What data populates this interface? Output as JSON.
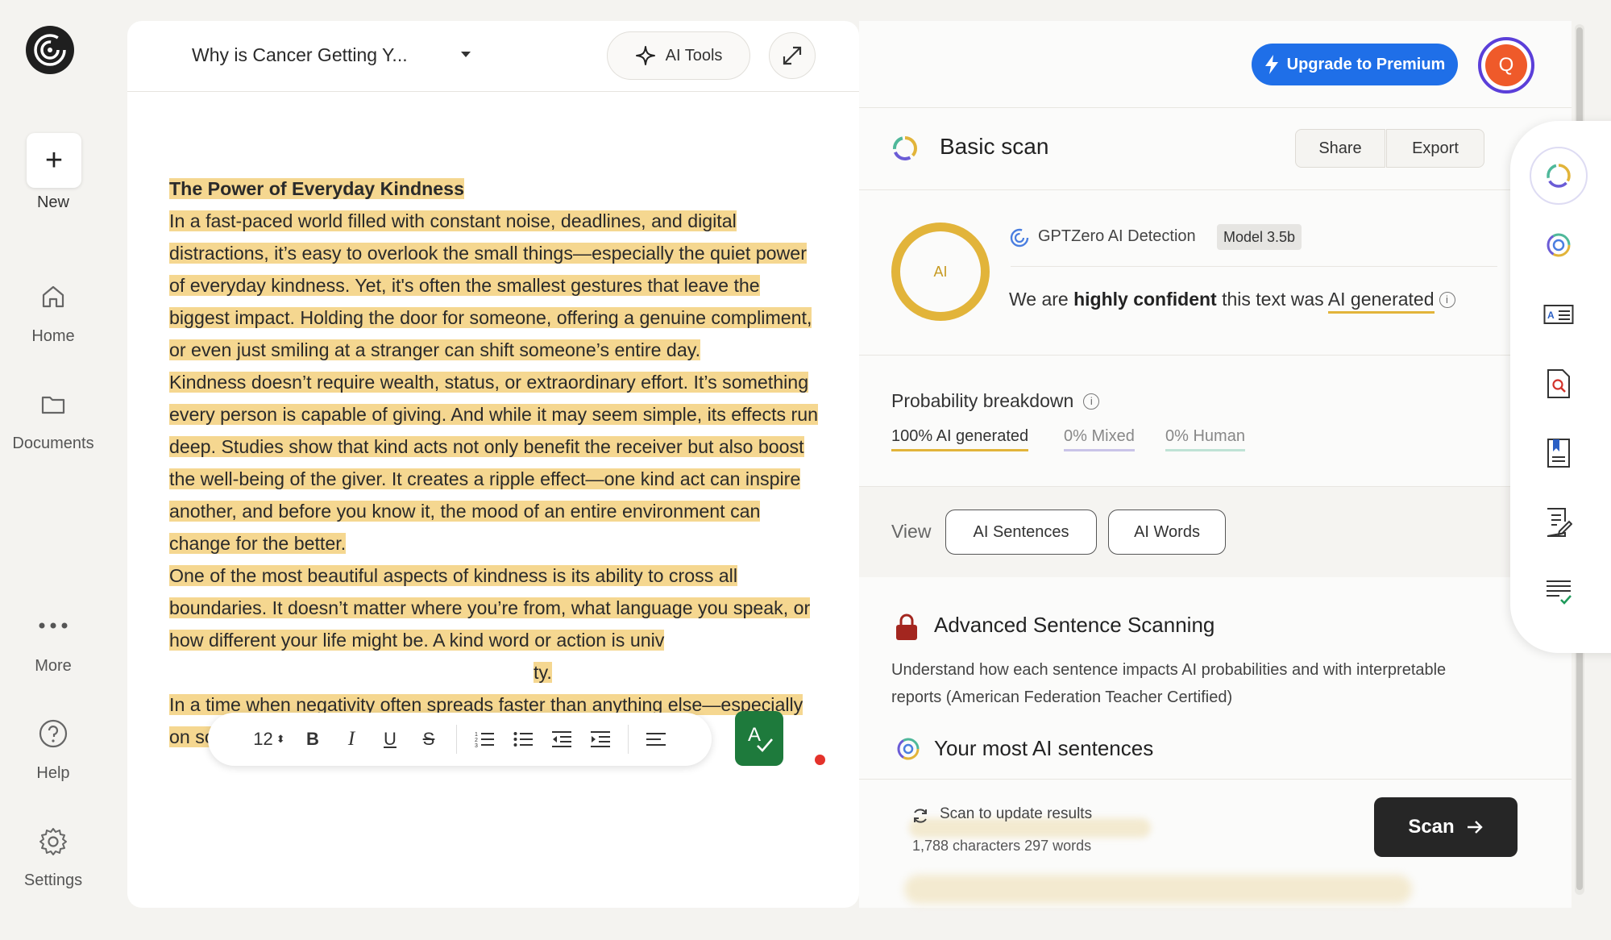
{
  "nav": {
    "new_label": "New",
    "items": [
      {
        "label": "Home",
        "icon": "home-icon"
      },
      {
        "label": "Documents",
        "icon": "folder-icon"
      },
      {
        "label": "More",
        "icon": "more-icon"
      },
      {
        "label": "Help",
        "icon": "help-icon"
      },
      {
        "label": "Settings",
        "icon": "gear-icon"
      }
    ]
  },
  "editor": {
    "doc_title": "Why is Cancer Getting Y...",
    "ai_tools_label": "AI Tools",
    "heading": "The Power of Everyday Kindness",
    "p1": "In a fast-paced world filled with constant noise, deadlines, and digital distractions, it’s easy to overlook the small things—especially the quiet power of everyday kindness. Yet, it's often the smallest gestures that leave the biggest impact. Holding the door for someone, offering a genuine compliment, or even just smiling at a stranger can shift someone’s entire day.",
    "p2": "Kindness doesn’t require wealth, status, or extraordinary effort. It’s something every person is capable of giving. And while it may seem simple, its effects run deep. Studies show that kind acts not only benefit the receiver but also boost the well-being of the giver. It creates a ripple effect—one kind act can inspire another, and before you know it, the mood of an entire environment can change for the better.",
    "p3": "One of the most beautiful aspects of kindness is its ability to cross all boundaries. It doesn’t matter where you’re from, what language you speak, or how different your life might be. A kind word or action is univ",
    "p3_tail": "ty.",
    "p4": "In a time when negativity often spreads faster than anything else—especially on social media—choosing kindness is a powerful act of",
    "font_size": "12"
  },
  "panel": {
    "premium_label": "Upgrade to Premium",
    "avatar_initial": "Q",
    "scan_title": "Basic scan",
    "share_label": "Share",
    "export_label": "Export",
    "ring_label": "AI",
    "detector_label": "GPTZero AI Detection",
    "model_badge": "Model 3.5b",
    "confidence_prefix": "We are ",
    "confidence_strong": "highly confident",
    "confidence_mid": " this text was ",
    "confidence_result": "AI generated",
    "prob_title": "Probability breakdown",
    "prob_ai": "100% AI generated",
    "prob_mixed": "0% Mixed",
    "prob_human": "0% Human",
    "view_label": "View",
    "view_sentences": "AI Sentences",
    "view_words": "AI Words",
    "adv_title": "Advanced Sentence Scanning",
    "adv_desc": "Understand how each sentence impacts AI probabilities and with interpretable reports (American Federation Teacher Certified)",
    "most_title": "Your most AI sentences",
    "update_text": "Scan to update results",
    "char_count": "1,788 characters 297 words",
    "scan_label": "Scan"
  },
  "colors": {
    "highlight": "#f5d790",
    "accent_blue": "#1f6fe8",
    "ai_yellow": "#e2b43a",
    "grammar_green": "#1e7a3c"
  }
}
